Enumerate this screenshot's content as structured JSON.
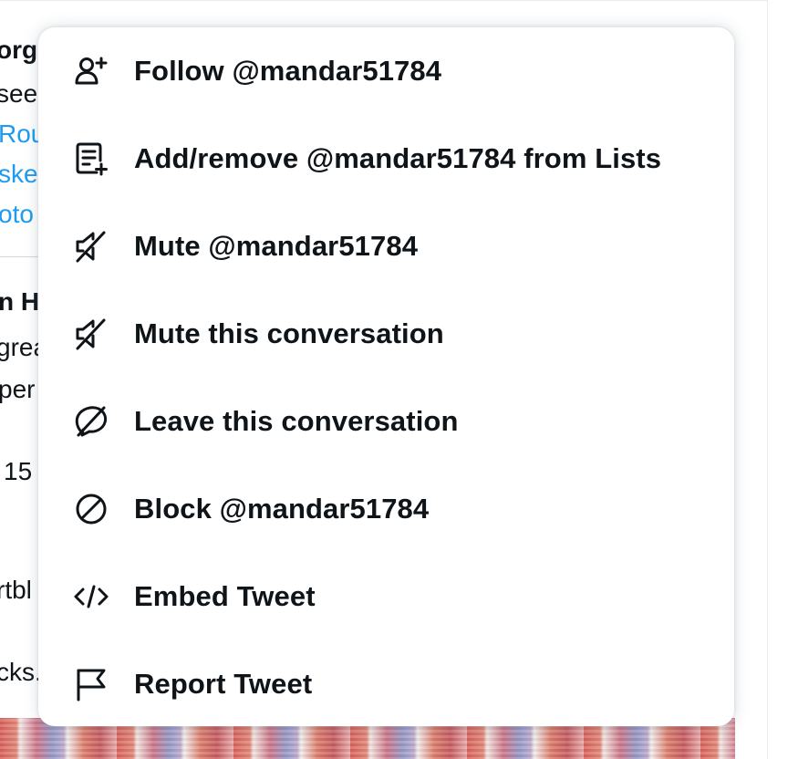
{
  "background": {
    "fragments": [
      {
        "text": "org",
        "style": "bold"
      },
      {
        "text": "see",
        "style": "normal"
      },
      {
        "text": "Rou",
        "style": "link"
      },
      {
        "text": "ske",
        "style": "link"
      },
      {
        "text": "oto",
        "style": "link"
      },
      {
        "text": "n H",
        "style": "bold"
      },
      {
        "text": "grea",
        "style": "normal"
      },
      {
        "text": "per",
        "style": "normal"
      },
      {
        "text": "15",
        "style": "normal"
      },
      {
        "text": "rtbl",
        "style": "normal"
      },
      {
        "text": "cks.",
        "style": "normal"
      }
    ]
  },
  "menu": {
    "items": [
      {
        "label": "Follow @mandar51784",
        "icon": "follow-user-icon"
      },
      {
        "label": "Add/remove @mandar51784 from Lists",
        "icon": "list-add-icon"
      },
      {
        "label": "Mute @mandar51784",
        "icon": "mute-icon"
      },
      {
        "label": "Mute this conversation",
        "icon": "mute-icon"
      },
      {
        "label": "Leave this conversation",
        "icon": "leave-icon"
      },
      {
        "label": "Block @mandar51784",
        "icon": "block-icon"
      },
      {
        "label": "Embed Tweet",
        "icon": "embed-code-icon"
      },
      {
        "label": "Report Tweet",
        "icon": "flag-icon"
      }
    ]
  },
  "colors": {
    "text": "#0f1419",
    "link": "#1d9bf0",
    "menu_bg": "#ffffff"
  }
}
